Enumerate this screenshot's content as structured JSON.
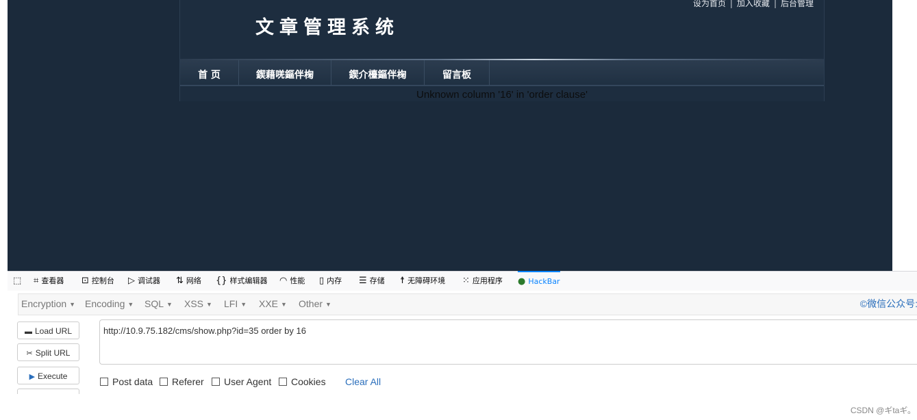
{
  "site": {
    "title": "文章管理系统",
    "top_links": [
      "设为首页",
      "加入收藏",
      "后台管理"
    ],
    "nav": [
      "首 页",
      "鍥藉唴鏂伴椈",
      "鍥介檯鏂伴椈",
      "留言板"
    ],
    "error_message": "Unknown column '16' in 'order clause'"
  },
  "devtools_tabs": [
    {
      "icon": "inspector-icon",
      "label": "查看器"
    },
    {
      "icon": "console-icon",
      "label": "控制台"
    },
    {
      "icon": "debugger-icon",
      "label": "调试器"
    },
    {
      "icon": "network-icon",
      "label": "网络"
    },
    {
      "icon": "style-editor-icon",
      "label": "样式编辑器"
    },
    {
      "icon": "performance-icon",
      "label": "性能"
    },
    {
      "icon": "memory-icon",
      "label": "内存"
    },
    {
      "icon": "storage-icon",
      "label": "存储"
    },
    {
      "icon": "accessibility-icon",
      "label": "无障碍环境"
    },
    {
      "icon": "application-icon",
      "label": "应用程序"
    },
    {
      "icon": "hackbar-icon",
      "label": "HackBar",
      "active": true
    }
  ],
  "hackbar": {
    "menu": [
      "Encryption",
      "Encoding",
      "SQL",
      "XSS",
      "LFI",
      "XXE",
      "Other"
    ],
    "wechat_text": "©微信公众号: ",
    "buttons": {
      "load_url": "Load URL",
      "split_url": "Split URL",
      "execute": "Execute"
    },
    "url_value": "http://10.9.75.182/cms/show.php?id=35 order by 16",
    "options": [
      "Post data",
      "Referer",
      "User Agent",
      "Cookies"
    ],
    "clear_all": "Clear All"
  },
  "watermark": "CSDN @ギtaギ。",
  "colors": {
    "site_bg": "#1b2a3b",
    "active_tab": "#0a84ff",
    "link": "#2a6ebb"
  }
}
